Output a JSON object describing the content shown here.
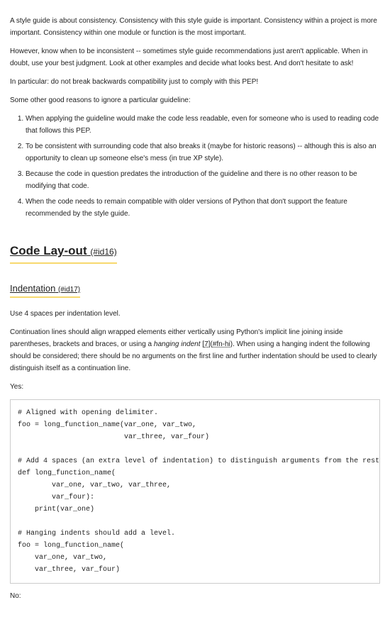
{
  "intro": {
    "p1": "A style guide is about consistency. Consistency with this style guide is important. Consistency within a project is more important. Consistency within one module or function is the most important.",
    "p2": "However, know when to be inconsistent -- sometimes style guide recommendations just aren't applicable. When in doubt, use your best judgment. Look at other examples and decide what looks best. And don't hesitate to ask!",
    "p3": "In particular: do not break backwards compatibility just to comply with this PEP!",
    "p4": "Some other good reasons to ignore a particular guideline:"
  },
  "reasons": [
    "When applying the guideline would make the code less readable, even for someone who is used to reading code that follows this PEP.",
    "To be consistent with surrounding code that also breaks it (maybe for historic reasons) -- although this is also an opportunity to clean up someone else's mess (in true XP style).",
    "Because the code in question predates the introduction of the guideline and there is no other reason to be modifying that code.",
    "When the code needs to remain compatible with older versions of Python that don't support the feature recommended by the style guide."
  ],
  "layout": {
    "heading": "Code Lay-out",
    "heading_anchor": "(#id16)"
  },
  "indentation": {
    "heading": "Indentation",
    "heading_anchor": "(#id17)",
    "p1": "Use 4 spaces per indentation level.",
    "p2a": "Continuation lines should align wrapped elements either vertically using Python's implicit line joining inside parentheses, brackets and braces, or using a ",
    "hanging_indent": "hanging indent",
    "ref_open": " [",
    "ref_num": "7",
    "ref_close": "](",
    "ref_link": "#fn-hi",
    "ref_end": "). When using a hanging indent the following should be considered; there should be no arguments on the first line and further indentation should be used to clearly distinguish itself as a continuation line.",
    "yes_label": "Yes:",
    "code_yes": "# Aligned with opening delimiter.\nfoo = long_function_name(var_one, var_two,\n                         var_three, var_four)\n\n# Add 4 spaces (an extra level of indentation) to distinguish arguments from the rest.\ndef long_function_name(\n        var_one, var_two, var_three,\n        var_four):\n    print(var_one)\n\n# Hanging indents should add a level.\nfoo = long_function_name(\n    var_one, var_two,\n    var_three, var_four)",
    "no_label": "No:"
  }
}
